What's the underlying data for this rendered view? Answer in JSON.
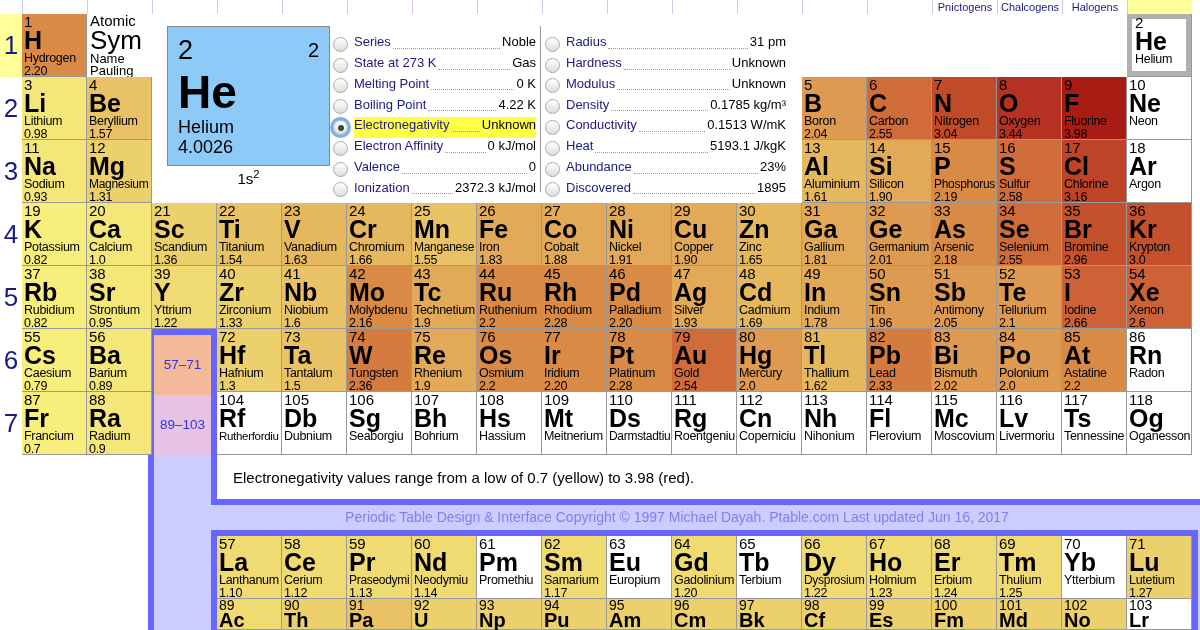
{
  "groups": [
    {
      "highlighted": false
    },
    {
      "highlighted": false
    },
    {
      "highlighted": false
    },
    {
      "highlighted": false
    },
    {
      "highlighted": false
    },
    {
      "highlighted": false
    },
    {
      "highlighted": false
    },
    {
      "highlighted": false
    },
    {
      "highlighted": false
    },
    {
      "highlighted": false
    },
    {
      "highlighted": false
    },
    {
      "highlighted": false
    },
    {
      "highlighted": false
    },
    {
      "highlighted": false
    },
    {
      "label": "Pnictogens",
      "highlighted": false
    },
    {
      "label": "Chalcogens",
      "highlighted": false
    },
    {
      "label": "Halogens",
      "highlighted": false
    },
    {
      "highlighted": true
    }
  ],
  "legend": {
    "number": "Atomic",
    "symbol": "Sym",
    "name": "Name",
    "value": "Pauling"
  },
  "detail": {
    "number": "2",
    "shells": "2",
    "symbol": "He",
    "name": "Helium",
    "mass": "4.0026",
    "configuration": "1s$^{2}$"
  },
  "property_columns": [
    [
      {
        "label": "Series",
        "value": "Noble",
        "selected": false
      },
      {
        "label": "State at 273 K",
        "value": "Gas",
        "selected": false
      },
      {
        "label": "Melting Point",
        "value": "0 K",
        "selected": false
      },
      {
        "label": "Boiling Point",
        "value": "4.22 K",
        "selected": false
      },
      {
        "label": "Electronegativity",
        "value": "Unknown",
        "selected": true
      },
      {
        "label": "Electron Affinity",
        "value": "0 kJ/mol",
        "selected": false
      },
      {
        "label": "Valence",
        "value": "0",
        "selected": false
      },
      {
        "label": "Ionization",
        "value": "2372.3 kJ/mol",
        "selected": false
      }
    ],
    [
      {
        "label": "Radius",
        "value": "31 pm",
        "selected": false
      },
      {
        "label": "Hardness",
        "value": "Unknown",
        "selected": false
      },
      {
        "label": "Modulus",
        "value": "Unknown",
        "selected": false
      },
      {
        "label": "Density",
        "value": "0.1785 kg/m³",
        "selected": false
      },
      {
        "label": "Conductivity",
        "value": "0.1513 W/mK",
        "selected": false
      },
      {
        "label": "Heat",
        "value": "5193.1 J/kgK",
        "selected": false
      },
      {
        "label": "Abundance",
        "value": "23%",
        "selected": false
      },
      {
        "label": "Discovered",
        "value": "1895",
        "selected": false
      }
    ]
  ],
  "periods": [
    {
      "label": "1",
      "highlighted": true,
      "elements": [
        {
          "number": "1",
          "symbol": "H",
          "name": "Hydrogen",
          "value": "2.20",
          "color": "#d98b46",
          "selected": false
        },
        {
          "number": "2",
          "symbol": "He",
          "name": "Helium",
          "color": "#ffffff",
          "selected": true
        }
      ]
    },
    {
      "label": "2",
      "highlighted": false,
      "elements": [
        {
          "number": "3",
          "symbol": "Li",
          "name": "Lithium",
          "value": "0.98",
          "color": "#f5e67a",
          "selected": false
        },
        {
          "number": "4",
          "symbol": "Be",
          "name": "Beryllium",
          "value": "1.57",
          "color": "#e8c264",
          "selected": false
        },
        {
          "number": "5",
          "symbol": "B",
          "name": "Boron",
          "value": "2.04",
          "color": "#dd9a50",
          "selected": false
        },
        {
          "number": "6",
          "symbol": "C",
          "name": "Carbon",
          "value": "2.55",
          "color": "#d06c3a",
          "selected": false
        },
        {
          "number": "7",
          "symbol": "N",
          "name": "Nitrogen",
          "value": "3.04",
          "color": "#c14a28",
          "selected": false
        },
        {
          "number": "8",
          "symbol": "O",
          "name": "Oxygen",
          "value": "3.44",
          "color": "#b53222",
          "selected": false
        },
        {
          "number": "9",
          "symbol": "F",
          "name": "Fluorine",
          "value": "3.98",
          "color": "#a81c14",
          "selected": false
        },
        {
          "number": "10",
          "symbol": "Ne",
          "name": "Neon",
          "color": "#ffffff",
          "selected": false
        }
      ]
    },
    {
      "label": "3",
      "highlighted": false,
      "elements": [
        {
          "number": "11",
          "symbol": "Na",
          "name": "Sodium",
          "value": "0.93",
          "color": "#f5e67a",
          "selected": false
        },
        {
          "number": "12",
          "symbol": "Mg",
          "name": "Magnesium",
          "value": "1.31",
          "color": "#ecd06c",
          "selected": false
        },
        {
          "number": "13",
          "symbol": "Al",
          "name": "Aluminium",
          "value": "1.61",
          "color": "#e6b85e",
          "selected": false
        },
        {
          "number": "14",
          "symbol": "Si",
          "name": "Silicon",
          "value": "1.90",
          "color": "#e2aa58",
          "selected": false
        },
        {
          "number": "15",
          "symbol": "P",
          "name": "Phosphorus",
          "value": "2.19",
          "color": "#d98b46",
          "selected": false
        },
        {
          "number": "16",
          "symbol": "S",
          "name": "Sulfur",
          "value": "2.58",
          "color": "#d06c3a",
          "selected": false
        },
        {
          "number": "17",
          "symbol": "Cl",
          "name": "Chlorine",
          "value": "3.16",
          "color": "#bd4426",
          "selected": false
        },
        {
          "number": "18",
          "symbol": "Ar",
          "name": "Argon",
          "color": "#ffffff",
          "selected": false
        }
      ]
    },
    {
      "label": "4",
      "highlighted": false,
      "elements": [
        {
          "number": "19",
          "symbol": "K",
          "name": "Potassium",
          "value": "0.82",
          "color": "#f8ee7c",
          "selected": false
        },
        {
          "number": "20",
          "symbol": "Ca",
          "name": "Calcium",
          "value": "1.0",
          "color": "#f5e67a",
          "selected": false
        },
        {
          "number": "21",
          "symbol": "Sc",
          "name": "Scandium",
          "value": "1.36",
          "color": "#ecd06c",
          "selected": false
        },
        {
          "number": "22",
          "symbol": "Ti",
          "name": "Titanium",
          "value": "1.54",
          "color": "#e8c264",
          "selected": false
        },
        {
          "number": "23",
          "symbol": "V",
          "name": "Vanadium",
          "value": "1.63",
          "color": "#e6b85e",
          "selected": false
        },
        {
          "number": "24",
          "symbol": "Cr",
          "name": "Chromium",
          "value": "1.66",
          "color": "#e6b85e",
          "selected": false
        },
        {
          "number": "25",
          "symbol": "Mn",
          "name": "Manganese",
          "value": "1.55",
          "color": "#e8c264",
          "selected": false
        },
        {
          "number": "26",
          "symbol": "Fe",
          "name": "Iron",
          "value": "1.83",
          "color": "#e2aa58",
          "selected": false
        },
        {
          "number": "27",
          "symbol": "Co",
          "name": "Cobalt",
          "value": "1.88",
          "color": "#e2aa58",
          "selected": false
        },
        {
          "number": "28",
          "symbol": "Ni",
          "name": "Nickel",
          "value": "1.91",
          "color": "#e2aa58",
          "selected": false
        },
        {
          "number": "29",
          "symbol": "Cu",
          "name": "Copper",
          "value": "1.90",
          "color": "#e2aa58",
          "selected": false
        },
        {
          "number": "30",
          "symbol": "Zn",
          "name": "Zinc",
          "value": "1.65",
          "color": "#e6b85e",
          "selected": false
        },
        {
          "number": "31",
          "symbol": "Ga",
          "name": "Gallium",
          "value": "1.81",
          "color": "#e2aa58",
          "selected": false
        },
        {
          "number": "32",
          "symbol": "Ge",
          "name": "Germanium",
          "value": "2.01",
          "color": "#dd9a50",
          "selected": false
        },
        {
          "number": "33",
          "symbol": "As",
          "name": "Arsenic",
          "value": "2.18",
          "color": "#d98b46",
          "selected": false
        },
        {
          "number": "34",
          "symbol": "Se",
          "name": "Selenium",
          "value": "2.55",
          "color": "#d06c3a",
          "selected": false
        },
        {
          "number": "35",
          "symbol": "Br",
          "name": "Bromine",
          "value": "2.96",
          "color": "#c4502c",
          "selected": false
        },
        {
          "number": "36",
          "symbol": "Kr",
          "name": "Krypton",
          "value": "3.0",
          "color": "#c4502c",
          "selected": false
        }
      ]
    },
    {
      "label": "5",
      "highlighted": false,
      "elements": [
        {
          "number": "37",
          "symbol": "Rb",
          "name": "Rubidium",
          "value": "0.82",
          "color": "#f8ee7c",
          "selected": false
        },
        {
          "number": "38",
          "symbol": "Sr",
          "name": "Strontium",
          "value": "0.95",
          "color": "#f5e67a",
          "selected": false
        },
        {
          "number": "39",
          "symbol": "Y",
          "name": "Yttrium",
          "value": "1.22",
          "color": "#f0da72",
          "selected": false
        },
        {
          "number": "40",
          "symbol": "Zr",
          "name": "Zirconium",
          "value": "1.33",
          "color": "#ecd06c",
          "selected": false
        },
        {
          "number": "41",
          "symbol": "Nb",
          "name": "Niobium",
          "value": "1.6",
          "color": "#e8c264",
          "selected": false
        },
        {
          "number": "42",
          "symbol": "Mo",
          "name": "Molybdenu",
          "value": "2.16",
          "color": "#d98b46",
          "selected": false
        },
        {
          "number": "43",
          "symbol": "Tc",
          "name": "Technetium",
          "value": "1.9",
          "color": "#e2aa58",
          "selected": false
        },
        {
          "number": "44",
          "symbol": "Ru",
          "name": "Ruthenium",
          "value": "2.2",
          "color": "#d98b46",
          "selected": false
        },
        {
          "number": "45",
          "symbol": "Rh",
          "name": "Rhodium",
          "value": "2.28",
          "color": "#d98b46",
          "selected": false
        },
        {
          "number": "46",
          "symbol": "Pd",
          "name": "Palladium",
          "value": "2.20",
          "color": "#d98b46",
          "selected": false
        },
        {
          "number": "47",
          "symbol": "Ag",
          "name": "Silver",
          "value": "1.93",
          "color": "#e2aa58",
          "selected": false
        },
        {
          "number": "48",
          "symbol": "Cd",
          "name": "Cadmium",
          "value": "1.69",
          "color": "#e6b85e",
          "selected": false
        },
        {
          "number": "49",
          "symbol": "In",
          "name": "Indium",
          "value": "1.78",
          "color": "#e2aa58",
          "selected": false
        },
        {
          "number": "50",
          "symbol": "Sn",
          "name": "Tin",
          "value": "1.96",
          "color": "#dd9a50",
          "selected": false
        },
        {
          "number": "51",
          "symbol": "Sb",
          "name": "Antimony",
          "value": "2.05",
          "color": "#dd9a50",
          "selected": false
        },
        {
          "number": "52",
          "symbol": "Te",
          "name": "Tellurium",
          "value": "2.1",
          "color": "#dd9a50",
          "selected": false
        },
        {
          "number": "53",
          "symbol": "I",
          "name": "Iodine",
          "value": "2.66",
          "color": "#cc6236",
          "selected": false
        },
        {
          "number": "54",
          "symbol": "Xe",
          "name": "Xenon",
          "value": "2.6",
          "color": "#cc6236",
          "selected": false
        }
      ]
    },
    {
      "label": "6",
      "highlighted": false,
      "series": {
        "label": "57–71",
        "color": "#f4b99b"
      },
      "elements": [
        {
          "number": "55",
          "symbol": "Cs",
          "name": "Caesium",
          "value": "0.79",
          "color": "#f8ee7c",
          "selected": false
        },
        {
          "number": "56",
          "symbol": "Ba",
          "name": "Barium",
          "value": "0.89",
          "color": "#f5e67a",
          "selected": false
        },
        {
          "number": "72",
          "symbol": "Hf",
          "name": "Hafnium",
          "value": "1.3",
          "color": "#ecd06c",
          "selected": false
        },
        {
          "number": "73",
          "symbol": "Ta",
          "name": "Tantalum",
          "value": "1.5",
          "color": "#e8c264",
          "selected": false
        },
        {
          "number": "74",
          "symbol": "W",
          "name": "Tungsten",
          "value": "2.36",
          "color": "#d47c40",
          "selected": false
        },
        {
          "number": "75",
          "symbol": "Re",
          "name": "Rhenium",
          "value": "1.9",
          "color": "#e2aa58",
          "selected": false
        },
        {
          "number": "76",
          "symbol": "Os",
          "name": "Osmium",
          "value": "2.2",
          "color": "#d98b46",
          "selected": false
        },
        {
          "number": "77",
          "symbol": "Ir",
          "name": "Iridium",
          "value": "2.20",
          "color": "#d98b46",
          "selected": false
        },
        {
          "number": "78",
          "symbol": "Pt",
          "name": "Platinum",
          "value": "2.28",
          "color": "#d98b46",
          "selected": false
        },
        {
          "number": "79",
          "symbol": "Au",
          "name": "Gold",
          "value": "2.54",
          "color": "#d06c3a",
          "selected": false
        },
        {
          "number": "80",
          "symbol": "Hg",
          "name": "Mercury",
          "value": "2.0",
          "color": "#dd9a50",
          "selected": false
        },
        {
          "number": "81",
          "symbol": "Tl",
          "name": "Thallium",
          "value": "1.62",
          "color": "#e6b85e",
          "selected": false
        },
        {
          "number": "82",
          "symbol": "Pb",
          "name": "Lead",
          "value": "2.33",
          "color": "#d47c40",
          "selected": false
        },
        {
          "number": "83",
          "symbol": "Bi",
          "name": "Bismuth",
          "value": "2.02",
          "color": "#dd9a50",
          "selected": false
        },
        {
          "number": "84",
          "symbol": "Po",
          "name": "Polonium",
          "value": "2.0",
          "color": "#dd9a50",
          "selected": false
        },
        {
          "number": "85",
          "symbol": "At",
          "name": "Astatine",
          "value": "2.2",
          "color": "#d98b46",
          "selected": false
        },
        {
          "number": "86",
          "symbol": "Rn",
          "name": "Radon",
          "color": "#ffffff",
          "selected": false
        }
      ]
    },
    {
      "label": "7",
      "highlighted": false,
      "series": {
        "label": "89–103",
        "color": "#e6c3e3"
      },
      "elements": [
        {
          "number": "87",
          "symbol": "Fr",
          "name": "Francium",
          "value": "0.7",
          "color": "#f8ee7c",
          "selected": false
        },
        {
          "number": "88",
          "symbol": "Ra",
          "name": "Radium",
          "value": "0.9",
          "color": "#f5e67a",
          "selected": false
        },
        {
          "number": "104",
          "symbol": "Rf",
          "name": "Rutherfordiu",
          "color": "#ffffff",
          "selected": false
        },
        {
          "number": "105",
          "symbol": "Db",
          "name": "Dubnium",
          "color": "#ffffff",
          "selected": false
        },
        {
          "number": "106",
          "symbol": "Sg",
          "name": "Seaborgiu",
          "color": "#ffffff",
          "selected": false
        },
        {
          "number": "107",
          "symbol": "Bh",
          "name": "Bohrium",
          "color": "#ffffff",
          "selected": false
        },
        {
          "number": "108",
          "symbol": "Hs",
          "name": "Hassium",
          "color": "#ffffff",
          "selected": false
        },
        {
          "number": "109",
          "symbol": "Mt",
          "name": "Meitnerium",
          "color": "#ffffff",
          "selected": false
        },
        {
          "number": "110",
          "symbol": "Ds",
          "name": "Darmstadtiu",
          "color": "#ffffff",
          "selected": false
        },
        {
          "number": "111",
          "symbol": "Rg",
          "name": "Roentgeniu",
          "color": "#ffffff",
          "selected": false
        },
        {
          "number": "112",
          "symbol": "Cn",
          "name": "Coperniciu",
          "color": "#ffffff",
          "selected": false
        },
        {
          "number": "113",
          "symbol": "Nh",
          "name": "Nihonium",
          "color": "#ffffff",
          "selected": false
        },
        {
          "number": "114",
          "symbol": "Fl",
          "name": "Flerovium",
          "color": "#ffffff",
          "selected": false
        },
        {
          "number": "115",
          "symbol": "Mc",
          "name": "Moscovium",
          "color": "#ffffff",
          "selected": false
        },
        {
          "number": "116",
          "symbol": "Lv",
          "name": "Livermoriu",
          "color": "#ffffff",
          "selected": false
        },
        {
          "number": "117",
          "symbol": "Ts",
          "name": "Tennessine",
          "color": "#ffffff",
          "selected": false
        },
        {
          "number": "118",
          "symbol": "Og",
          "name": "Oganesson",
          "color": "#ffffff",
          "selected": false
        }
      ]
    }
  ],
  "note": "Electronegativity values range from a low of 0.7 (yellow) to 3.98 (red).",
  "credit": {
    "before": "Periodic Table Design & Interface Copyright © 1997 ",
    "link": "Michael Dayah",
    "after": ". Ptable.com Last updated Jun 16, 2017"
  },
  "lanthanides": [
    {
      "number": "57",
      "symbol": "La",
      "name": "Lanthanum",
      "value": "1.10",
      "color": "#f0da72",
      "selected": false
    },
    {
      "number": "58",
      "symbol": "Ce",
      "name": "Cerium",
      "value": "1.12",
      "color": "#f0da72",
      "selected": false
    },
    {
      "number": "59",
      "symbol": "Pr",
      "name": "Praseodymi",
      "value": "1.13",
      "color": "#f0da72",
      "selected": false
    },
    {
      "number": "60",
      "symbol": "Nd",
      "name": "Neodymiu",
      "value": "1.14",
      "color": "#f0da72",
      "selected": false
    },
    {
      "number": "61",
      "symbol": "Pm",
      "name": "Promethiu",
      "color": "#ffffff",
      "selected": false
    },
    {
      "number": "62",
      "symbol": "Sm",
      "name": "Samarium",
      "value": "1.17",
      "color": "#f0da72",
      "selected": false
    },
    {
      "number": "63",
      "symbol": "Eu",
      "name": "Europium",
      "color": "#ffffff",
      "selected": false
    },
    {
      "number": "64",
      "symbol": "Gd",
      "name": "Gadolinium",
      "value": "1.20",
      "color": "#f0da72",
      "selected": false
    },
    {
      "number": "65",
      "symbol": "Tb",
      "name": "Terbium",
      "color": "#ffffff",
      "selected": false
    },
    {
      "number": "66",
      "symbol": "Dy",
      "name": "Dysprosium",
      "value": "1.22",
      "color": "#f0da72",
      "selected": false
    },
    {
      "number": "67",
      "symbol": "Ho",
      "name": "Holmium",
      "value": "1.23",
      "color": "#f0da72",
      "selected": false
    },
    {
      "number": "68",
      "symbol": "Er",
      "name": "Erbium",
      "value": "1.24",
      "color": "#f0da72",
      "selected": false
    },
    {
      "number": "69",
      "symbol": "Tm",
      "name": "Thulium",
      "value": "1.25",
      "color": "#f0da72",
      "selected": false
    },
    {
      "number": "70",
      "symbol": "Yb",
      "name": "Ytterbium",
      "color": "#ffffff",
      "selected": false
    },
    {
      "number": "71",
      "symbol": "Lu",
      "name": "Lutetium",
      "value": "1.27",
      "color": "#ecd06c",
      "selected": false
    }
  ],
  "actinides": [
    {
      "number": "89",
      "symbol": "Ac",
      "color": "#f0da72",
      "selected": false
    },
    {
      "number": "90",
      "symbol": "Th",
      "color": "#ecd06c",
      "selected": false
    },
    {
      "number": "91",
      "symbol": "Pa",
      "color": "#e8c264",
      "selected": false
    },
    {
      "number": "92",
      "symbol": "U",
      "color": "#ecd06c",
      "selected": false
    },
    {
      "number": "93",
      "symbol": "Np",
      "color": "#ecd06c",
      "selected": false
    },
    {
      "number": "94",
      "symbol": "Pu",
      "color": "#ecd06c",
      "selected": false
    },
    {
      "number": "95",
      "symbol": "Am",
      "color": "#ecd06c",
      "selected": false
    },
    {
      "number": "96",
      "symbol": "Cm",
      "color": "#ecd06c",
      "selected": false
    },
    {
      "number": "97",
      "symbol": "Bk",
      "color": "#ecd06c",
      "selected": false
    },
    {
      "number": "98",
      "symbol": "Cf",
      "color": "#ecd06c",
      "selected": false
    },
    {
      "number": "99",
      "symbol": "Es",
      "color": "#ecd06c",
      "selected": false
    },
    {
      "number": "100",
      "symbol": "Fm",
      "color": "#ecd06c",
      "selected": false
    },
    {
      "number": "101",
      "symbol": "Md",
      "color": "#ecd06c",
      "selected": false
    },
    {
      "number": "102",
      "symbol": "No",
      "color": "#ecd06c",
      "selected": false
    },
    {
      "number": "103",
      "symbol": "Lr",
      "color": "#ffffff",
      "selected": false
    }
  ]
}
